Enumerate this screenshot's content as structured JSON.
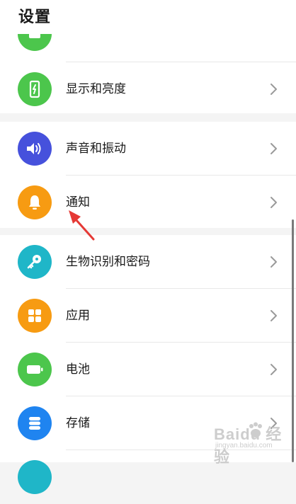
{
  "header": {
    "title": "设置"
  },
  "colors": {
    "green": "#4cc64c",
    "blue_purple": "#4651dc",
    "orange": "#f79b12",
    "teal": "#1fb6c8",
    "blue": "#1f84f0",
    "annotation_red": "#e53935"
  },
  "settings": {
    "partial_top": {
      "label": "",
      "icon": "green-icon"
    },
    "display": {
      "label": "显示和亮度",
      "icon": "phone-brightness-icon"
    },
    "sound": {
      "label": "声音和振动",
      "icon": "speaker-icon"
    },
    "notifications": {
      "label": "通知",
      "icon": "bell-icon"
    },
    "biometrics": {
      "label": "生物识别和密码",
      "icon": "key-icon"
    },
    "apps": {
      "label": "应用",
      "icon": "apps-grid-icon"
    },
    "battery": {
      "label": "电池",
      "icon": "battery-icon"
    },
    "storage": {
      "label": "存储",
      "icon": "storage-icon"
    }
  },
  "watermark": {
    "text": "Baidu 经验",
    "sub": "jingyan.baidu.com"
  }
}
